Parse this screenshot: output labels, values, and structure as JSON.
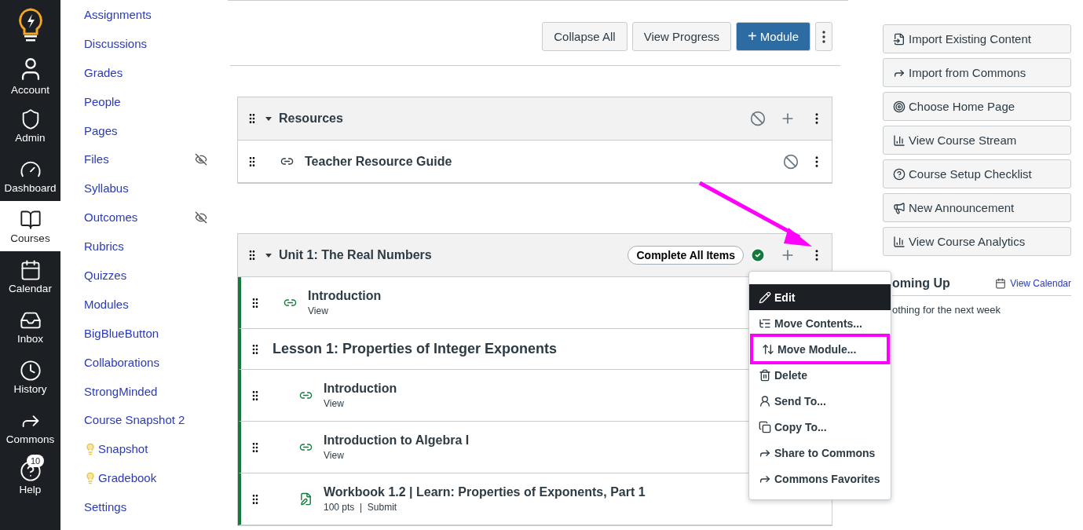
{
  "global_nav": [
    {
      "label": "Account",
      "selected": false
    },
    {
      "label": "Admin",
      "selected": false
    },
    {
      "label": "Dashboard",
      "selected": false
    },
    {
      "label": "Courses",
      "selected": true
    },
    {
      "label": "Calendar",
      "selected": false
    },
    {
      "label": "Inbox",
      "selected": false
    },
    {
      "label": "History",
      "selected": false
    },
    {
      "label": "Commons",
      "selected": false
    },
    {
      "label": "Help",
      "selected": false,
      "badge": "10"
    }
  ],
  "course_nav": [
    {
      "label": "Assignments"
    },
    {
      "label": "Discussions"
    },
    {
      "label": "Grades"
    },
    {
      "label": "People"
    },
    {
      "label": "Pages"
    },
    {
      "label": "Files",
      "hidden": true
    },
    {
      "label": "Syllabus"
    },
    {
      "label": "Outcomes",
      "hidden": true
    },
    {
      "label": "Rubrics"
    },
    {
      "label": "Quizzes"
    },
    {
      "label": "Modules"
    },
    {
      "label": "BigBlueButton"
    },
    {
      "label": "Collaborations"
    },
    {
      "label": "StrongMinded"
    },
    {
      "label": "Course Snapshot 2"
    },
    {
      "label": "Snapshot",
      "bulb": true
    },
    {
      "label": "Gradebook",
      "bulb": true
    },
    {
      "label": "Settings"
    }
  ],
  "toolbar": {
    "buttons": [
      "Collapse All",
      "View Progress"
    ],
    "add_button": "Module",
    "add_icon": "+"
  },
  "modules": [
    {
      "title": "Resources",
      "published": false,
      "expanded": true,
      "items": [
        {
          "kind": "link",
          "title": "Teacher Resource Guide",
          "published": false
        }
      ]
    },
    {
      "title": "Unit 1: The Real Numbers",
      "published": true,
      "expanded": true,
      "complete_label": "Complete All Items",
      "items": [
        {
          "kind": "link",
          "title": "Introduction",
          "meta": "View"
        },
        {
          "kind": "header",
          "title": "Lesson 1: Properties of Integer Exponents",
          "children": [
            {
              "kind": "link",
              "title": "Introduction",
              "meta": "View"
            },
            {
              "kind": "link",
              "title": "Introduction to Algebra I",
              "meta": "View"
            },
            {
              "kind": "assignment",
              "title": "Workbook 1.2 | Learn: Properties of Exponents, Part 1",
              "meta": "100 pts  |  Submit"
            }
          ]
        }
      ]
    }
  ],
  "menu": [
    {
      "label": "Edit",
      "selected": true,
      "highlighted": false
    },
    {
      "label": "Move Contents...",
      "selected": false,
      "highlighted": false
    },
    {
      "label": "Move Module...",
      "selected": false,
      "highlighted": true
    },
    {
      "label": "Delete",
      "selected": false,
      "highlighted": false
    },
    {
      "label": "Send To...",
      "selected": false,
      "highlighted": false
    },
    {
      "label": "Copy To...",
      "selected": false,
      "highlighted": false
    },
    {
      "label": "Share to Commons",
      "selected": false,
      "highlighted": false
    },
    {
      "label": "Commons Favorites",
      "selected": false,
      "highlighted": false
    }
  ],
  "sidebar_buttons": [
    {
      "label": "Import Existing Content"
    },
    {
      "label": "Import from Commons"
    },
    {
      "label": "Choose Home Page"
    },
    {
      "label": "View Course Stream"
    },
    {
      "label": "Course Setup Checklist"
    },
    {
      "label": "New Announcement"
    },
    {
      "label": "View Course Analytics"
    }
  ],
  "coming_up": {
    "title": "oming Up",
    "link": "View Calendar",
    "empty": "othing for the next week"
  }
}
